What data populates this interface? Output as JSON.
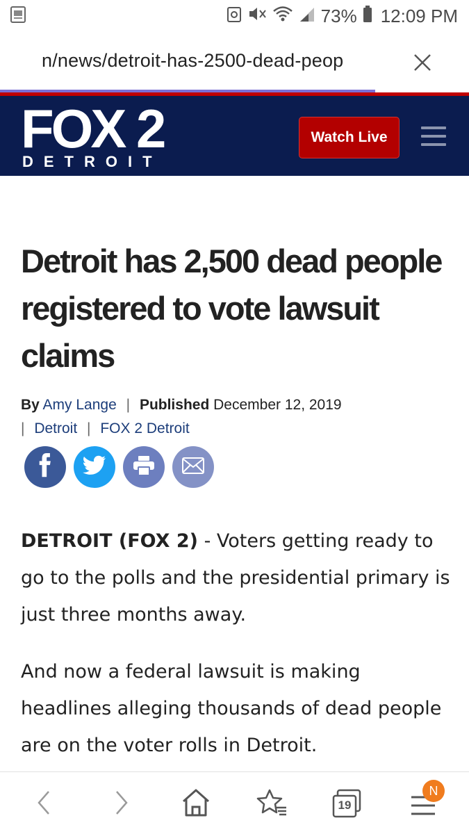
{
  "status_bar": {
    "battery_percent": "73%",
    "time": "12:09 PM"
  },
  "browser": {
    "url": "n/news/detroit-has-2500-dead-peop",
    "load_progress": 0.8,
    "tabs_count": "19",
    "notification_badge": "N"
  },
  "header": {
    "logo_main": "FOX 2",
    "logo_sub": "DETROIT",
    "watch_live_label": "Watch Live",
    "brand_navy": "#0b1c4f",
    "brand_red": "#b30000"
  },
  "article": {
    "headline": "Detroit has 2,500 dead people registered to vote lawsuit claims",
    "byline_prefix": "By",
    "author": "Amy Lange",
    "published_label": "Published",
    "published_date": "December 12, 2019",
    "section": "Detroit",
    "outlet": "FOX 2 Detroit",
    "share_icons": [
      "facebook-icon",
      "twitter-icon",
      "print-icon",
      "email-icon"
    ],
    "dateline": "DETROIT (FOX 2)",
    "para1_text": " - Voters getting ready to go to the polls and the presidential primary is just three months away.",
    "para2_text": "And now a federal lawsuit is making headlines alleging thousands of dead people are on the voter rolls in Detroit."
  }
}
